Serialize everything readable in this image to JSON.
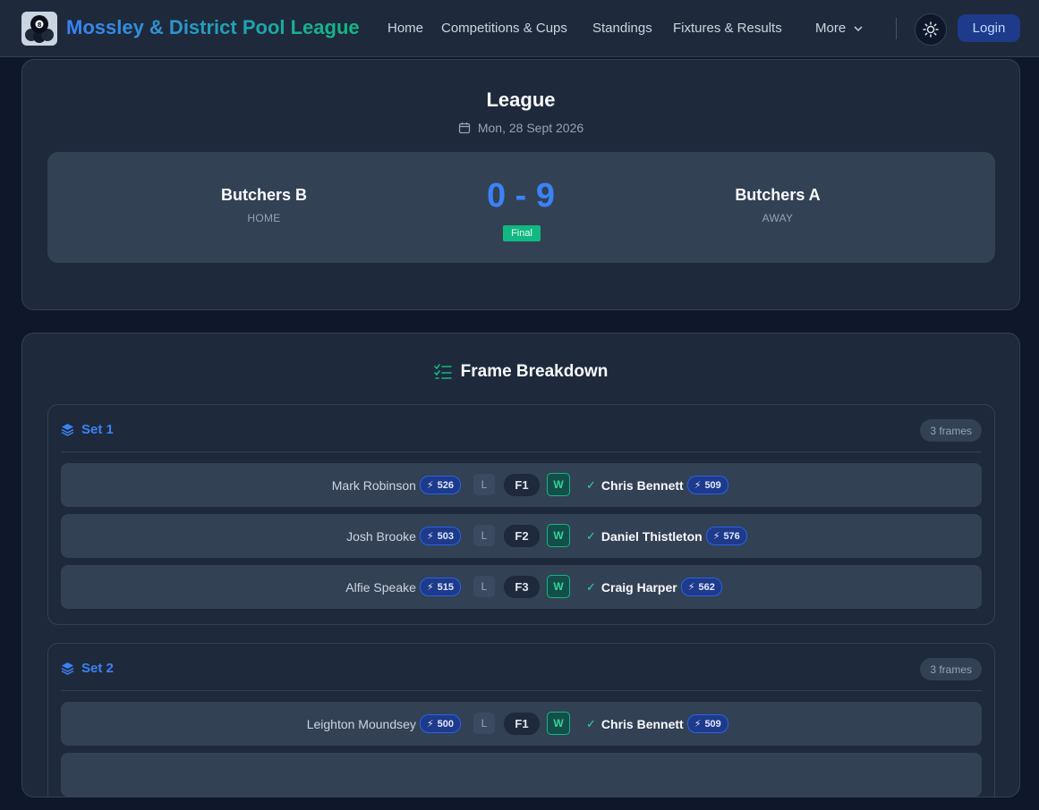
{
  "nav": {
    "brand": "Mossley & District Pool League",
    "links": [
      "Home",
      "Competitions & Cups",
      "Standings",
      "Fixtures & Results"
    ],
    "more_label": "More",
    "login_label": "Login",
    "icons": {
      "logo": "eight-ball-logo",
      "theme": "sun-icon",
      "more": "chevron-down-icon"
    }
  },
  "match": {
    "competition": "League",
    "date": "Mon, 28 Sept 2026",
    "home_team": "Butchers B",
    "home_label": "HOME",
    "away_team": "Butchers A",
    "away_label": "AWAY",
    "score": "0 - 9",
    "status": "Final"
  },
  "breakdown": {
    "title": "Frame Breakdown",
    "sets": [
      {
        "label": "Set 1",
        "frames_count": "3 frames",
        "frames": [
          {
            "num": "F1",
            "home_player": "Mark Robinson",
            "home_rating": "526",
            "home_result": "L",
            "away_result": "W",
            "away_player": "Chris Bennett",
            "away_rating": "509"
          },
          {
            "num": "F2",
            "home_player": "Josh Brooke",
            "home_rating": "503",
            "home_result": "L",
            "away_result": "W",
            "away_player": "Daniel Thistleton",
            "away_rating": "576"
          },
          {
            "num": "F3",
            "home_player": "Alfie Speake",
            "home_rating": "515",
            "home_result": "L",
            "away_result": "W",
            "away_player": "Craig Harper",
            "away_rating": "562"
          }
        ]
      },
      {
        "label": "Set 2",
        "frames_count": "3 frames",
        "frames": [
          {
            "num": "F1",
            "home_player": "Leighton Moundsey",
            "home_rating": "500",
            "home_result": "L",
            "away_result": "W",
            "away_player": "Chris Bennett",
            "away_rating": "509"
          }
        ]
      }
    ]
  },
  "colors": {
    "accent": "#3b82f6",
    "success": "#10b981",
    "background": "#0f172a",
    "card": "#1e293b"
  }
}
